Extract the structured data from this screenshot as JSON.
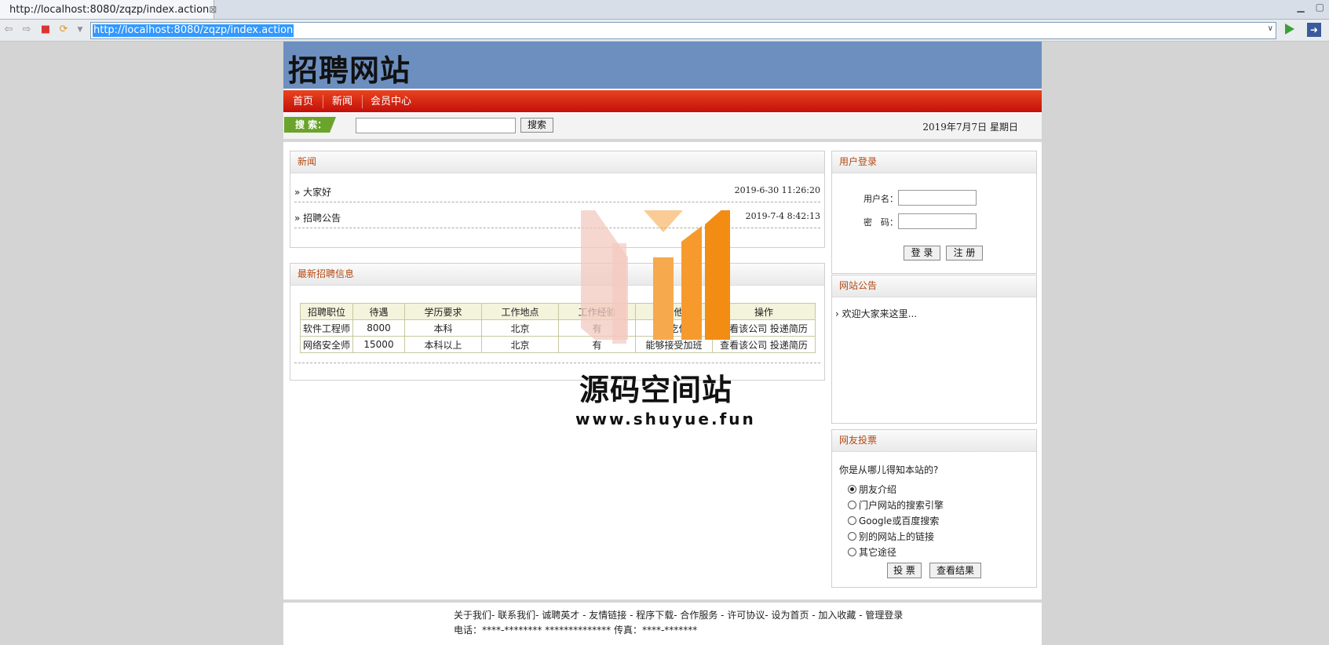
{
  "browser": {
    "tab_title": "http://localhost:8080/zqzp/index.action",
    "tab_close": "⊠",
    "url": "http://localhost:8080/zqzp/index.action"
  },
  "site": {
    "logo": "招聘网站",
    "menu": [
      "首页",
      "新闻",
      "会员中心"
    ],
    "search_tag": "搜 索：",
    "search_button": "搜索",
    "date": "2019年7月7日 星期日"
  },
  "news": {
    "title": "新闻",
    "items": [
      {
        "title": "大家好",
        "time": "2019-6-30 11:26:20"
      },
      {
        "title": "招聘公告",
        "time": "2019-7-4 8:42:13"
      }
    ]
  },
  "jobs": {
    "title": "最新招聘信息",
    "columns": [
      "招聘职位",
      "待遇",
      "学历要求",
      "工作地点",
      "工作经验",
      "其他",
      "操作"
    ],
    "rows": [
      [
        "软件工程师",
        "8000",
        "本科",
        "北京",
        "有",
        "包吃住",
        "查看该公司 投递简历"
      ],
      [
        "网络安全师",
        "15000",
        "本科以上",
        "北京",
        "有",
        "能够接受加班",
        "查看该公司 投递简历"
      ]
    ]
  },
  "login": {
    "title": "用户登录",
    "username_label": "用户名：",
    "password_label": "密　码：",
    "login_button": "登 录",
    "register_button": "注 册"
  },
  "notice": {
    "title": "网站公告",
    "text": "欢迎大家来这里..."
  },
  "vote": {
    "title": "网友投票",
    "question": "你是从哪儿得知本站的?",
    "options": [
      "朋友介绍",
      "门户网站的搜索引擎",
      "Google或百度搜索",
      "别的网站上的链接",
      "其它途径"
    ],
    "selected_index": 0,
    "vote_button": "投 票",
    "result_button": "查看结果"
  },
  "footer": {
    "links": "关于我们- 联系我们- 诚聘英才 - 友情链接 - 程序下载- 合作服务 - 许可协议- 设为首页 - 加入收藏 - 管理登录",
    "contact": "电话：****-******** ************** 传真：****-*******"
  },
  "watermark": {
    "title": "源码空间站",
    "url": "www.shuyue.fun",
    "colors": [
      "#f3c9c0",
      "#f7a94d",
      "#f28c12"
    ]
  }
}
